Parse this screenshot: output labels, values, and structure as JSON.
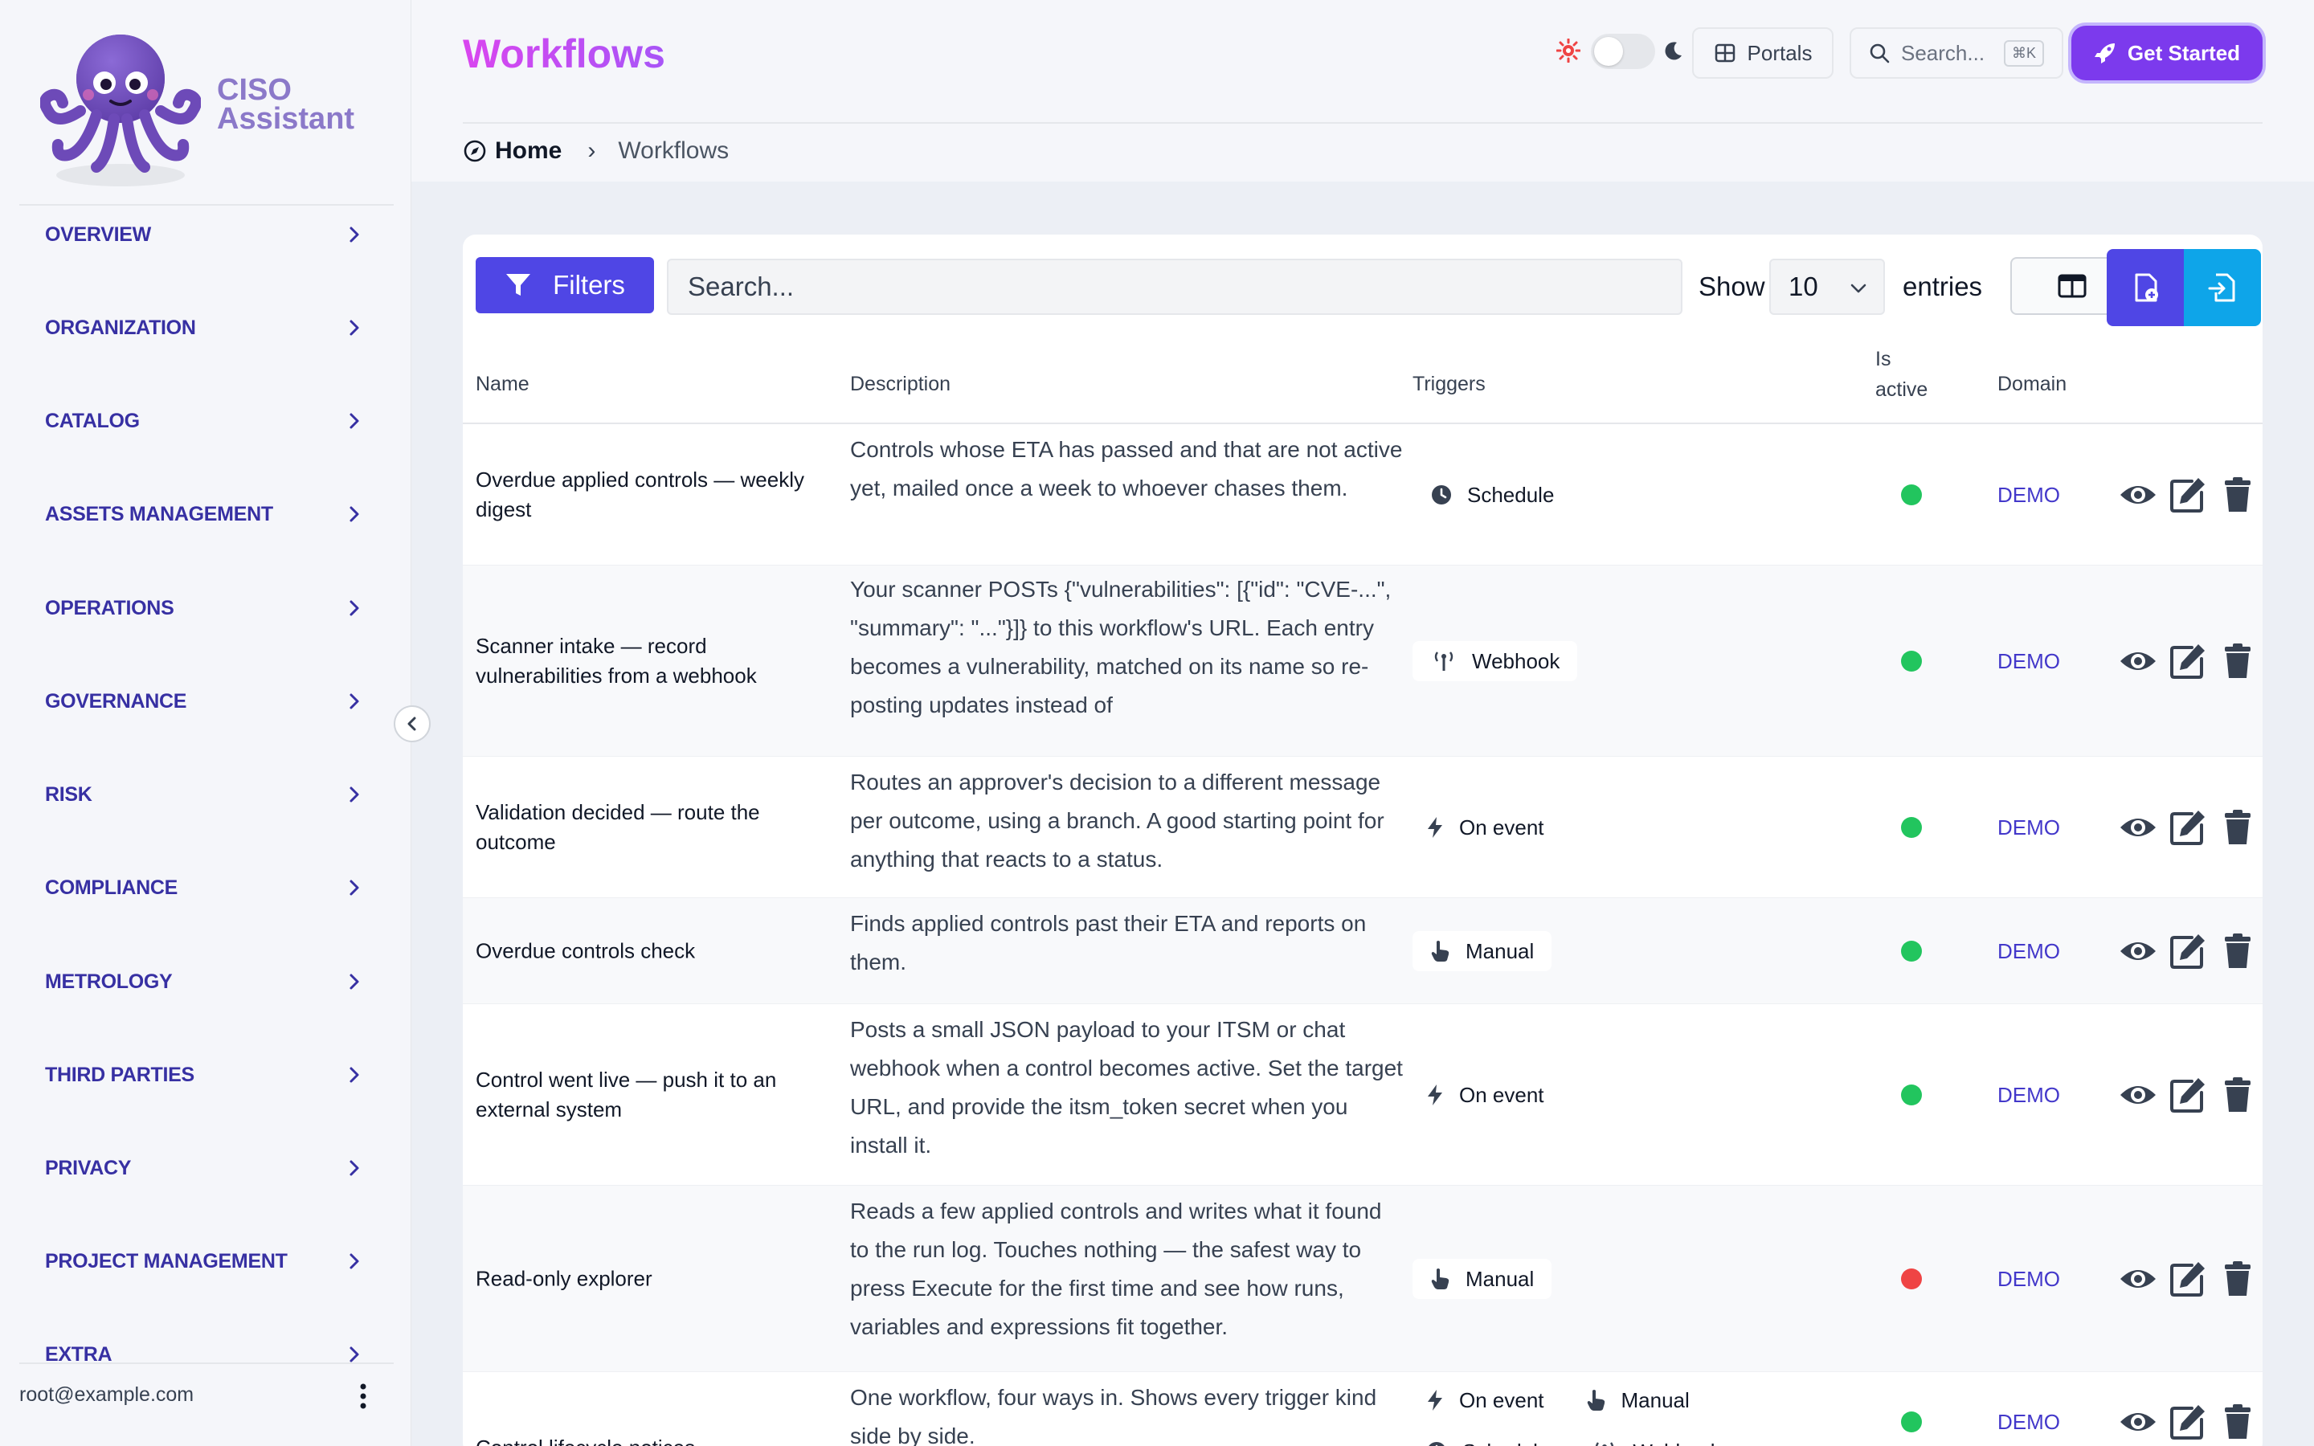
{
  "sidebar": {
    "logo_line1": "CISO",
    "logo_line2": "Assistant",
    "nav": [
      "OVERVIEW",
      "ORGANIZATION",
      "CATALOG",
      "ASSETS MANAGEMENT",
      "OPERATIONS",
      "GOVERNANCE",
      "RISK",
      "COMPLIANCE",
      "METROLOGY",
      "THIRD PARTIES",
      "PRIVACY",
      "PROJECT MANAGEMENT",
      "EXTRA"
    ],
    "user_email": "root@example.com"
  },
  "header": {
    "title": "Workflows",
    "breadcrumb_home": "Home",
    "breadcrumb_sep": "›",
    "breadcrumb_current": "Workflows",
    "portals_label": "Portals",
    "search_placeholder": "Search...",
    "search_shortcut": "⌘K",
    "get_started_label": "Get Started"
  },
  "toolbar": {
    "filters_label": "Filters",
    "search_placeholder": "Search...",
    "show_label": "Show",
    "entries_value": "10",
    "entries_label": "entries"
  },
  "table": {
    "headers": {
      "name": "Name",
      "description": "Description",
      "triggers": "Triggers",
      "is_active_1": "Is",
      "is_active_2": "active",
      "domain": "Domain"
    },
    "rows": [
      {
        "name": "Overdue applied controls — weekly digest",
        "description": "Controls whose ETA has passed and that are not active yet, mailed once a week to whoever chases them.",
        "triggers": [
          "Schedule"
        ],
        "active": true,
        "domain": "DEMO"
      },
      {
        "name": "Scanner intake — record vulnerabilities from a webhook",
        "description": "Your scanner POSTs {\"vulnerabilities\": [{\"id\": \"CVE-...\", \"summary\": \"...\"}]} to this workflow's URL. Each entry becomes a vulnerability, matched on its name so re-posting updates instead of",
        "triggers": [
          "Webhook"
        ],
        "active": true,
        "domain": "DEMO"
      },
      {
        "name": "Validation decided — route the outcome",
        "description": "Routes an approver's decision to a different message per outcome, using a branch. A good starting point for anything that reacts to a status.",
        "triggers": [
          "On event"
        ],
        "active": true,
        "domain": "DEMO"
      },
      {
        "name": "Overdue controls check",
        "description": "Finds applied controls past their ETA and reports on them.",
        "triggers": [
          "Manual"
        ],
        "active": true,
        "domain": "DEMO"
      },
      {
        "name": "Control went live — push it to an external system",
        "description": "Posts a small JSON payload to your ITSM or chat webhook when a control becomes active. Set the target URL, and provide the itsm_token secret when you install it.",
        "triggers": [
          "On event"
        ],
        "active": true,
        "domain": "DEMO"
      },
      {
        "name": "Read-only explorer",
        "description": "Reads a few applied controls and writes what it found to the run log. Touches nothing — the safest way to press Execute for the first time and see how runs, variables and expressions fit together.",
        "triggers": [
          "Manual"
        ],
        "active": false,
        "domain": "DEMO"
      },
      {
        "name": "Control lifecycle notices",
        "description": "One workflow, four ways in. Shows every trigger kind side by side.",
        "triggers": [
          "On event",
          "Manual",
          "Schedule",
          "Webhook"
        ],
        "active": true,
        "domain": "DEMO"
      }
    ]
  },
  "colors": {
    "accent": "#4f46e5",
    "nav": "#3730a3",
    "active": "#22c55e",
    "inactive": "#ef4444",
    "import": "#0ea5e9"
  }
}
